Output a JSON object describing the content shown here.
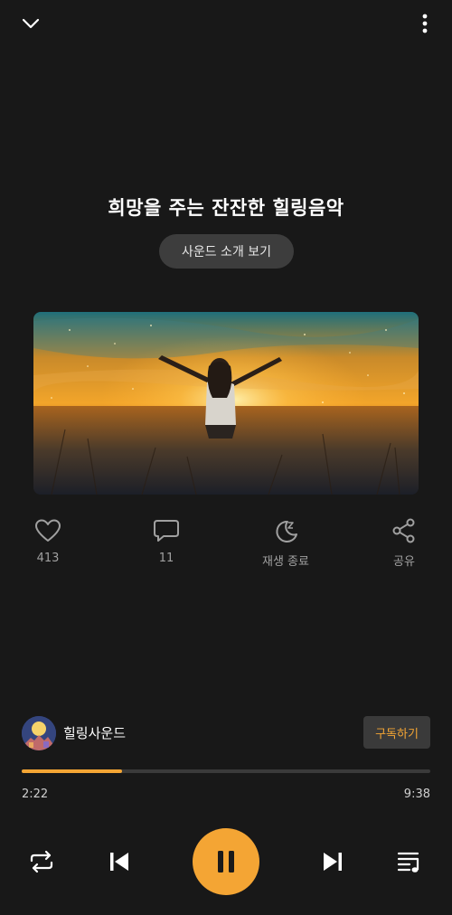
{
  "topbar": {
    "collapse_icon": "chevron-down-icon",
    "more_icon": "more-vertical-icon"
  },
  "track": {
    "title": "희망을 주는 잔잔한 힐링음악",
    "intro_button": "사운드 소개 보기"
  },
  "actions": {
    "like": {
      "icon": "heart-icon",
      "label": "413"
    },
    "comment": {
      "icon": "comment-icon",
      "label": "11"
    },
    "sleep": {
      "icon": "moon-sleep-icon",
      "label": "재생 종료"
    },
    "share": {
      "icon": "share-icon",
      "label": "공유"
    }
  },
  "channel": {
    "name": "힐링사운드",
    "subscribe_label": "구독하기"
  },
  "player": {
    "elapsed": "2:22",
    "total": "9:38",
    "progress": 0.246
  },
  "colors": {
    "background": "#181818",
    "accent": "#f4a534",
    "muted": "#a0a0a0"
  }
}
